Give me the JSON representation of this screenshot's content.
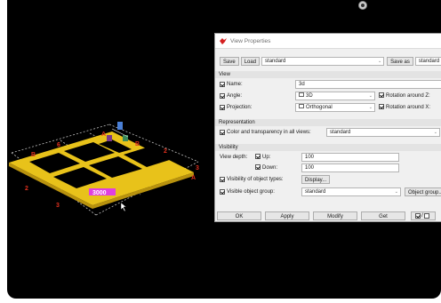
{
  "dialog": {
    "title": "View Properties",
    "toolbar": {
      "save_label": "Save",
      "load_label": "Load",
      "preset_value": "standard",
      "save_as_label": "Save as",
      "save_as_value": "standard"
    },
    "view": {
      "section_title": "View",
      "name_label": "Name:",
      "name_value": "3d",
      "angle_label": "Angle:",
      "angle_value": "3D",
      "rotation_z_label": "Rotation around Z:",
      "projection_label": "Projection:",
      "projection_value": "Orthogonal",
      "rotation_x_label": "Rotation around X:"
    },
    "representation": {
      "section_title": "Representation",
      "color_label": "Color and transparency in all views:",
      "color_value": "standard"
    },
    "visibility": {
      "section_title": "Visibility",
      "view_depth_label": "View depth:",
      "up_label": "Up:",
      "up_value": "100",
      "down_label": "Down:",
      "down_value": "100",
      "object_types_label": "Visibility of object types:",
      "display_button": "Display...",
      "object_group_label": "Visible object group:",
      "object_group_value": "standard",
      "object_group_button": "Object group..."
    },
    "buttons": {
      "ok": "OK",
      "apply": "Apply",
      "modify": "Modify",
      "get": "Get",
      "toggle": "/"
    }
  },
  "model": {
    "labels": {
      "red_6": "6",
      "red_2_right": "2",
      "red_3_right": "3",
      "red_a_right": "A",
      "red_2_left": "2",
      "red_3_left": "3",
      "red_b": "B",
      "red_a_top": "A",
      "red_b_top": "B",
      "dim": "3000"
    },
    "colors": {
      "beam": "#e8c21a",
      "beam_dark": "#b8920e",
      "label": "#e0301e",
      "dim": "#e040e0",
      "grid": "#bdbdbd"
    }
  }
}
